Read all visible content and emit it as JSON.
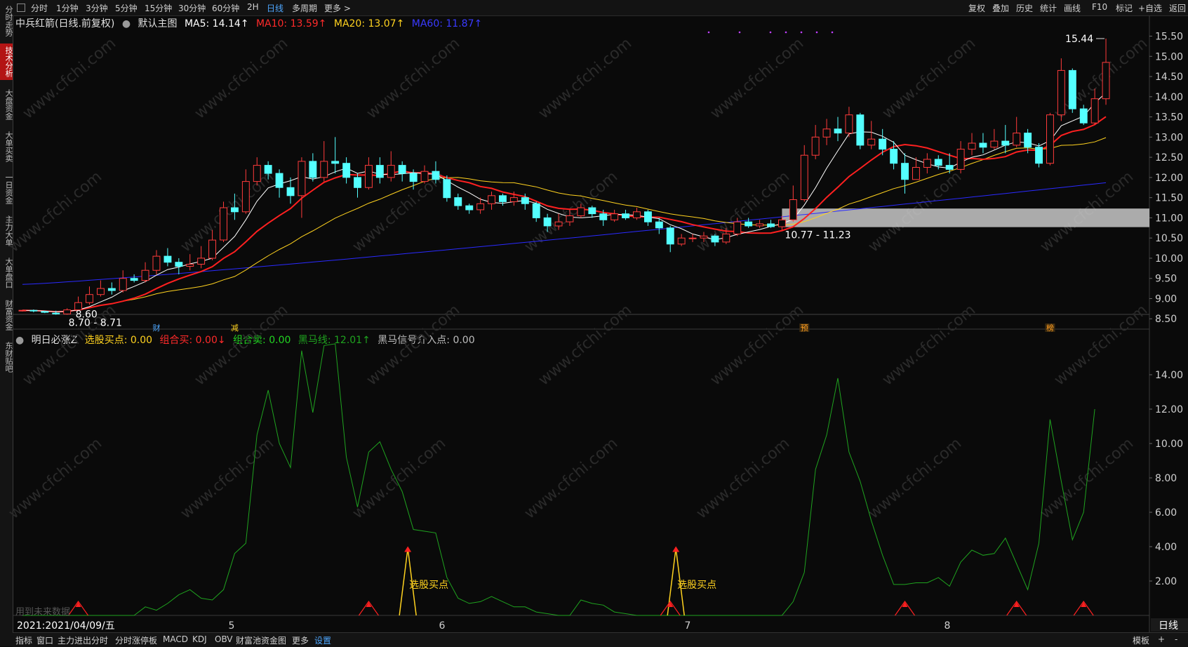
{
  "sidebar": {
    "items": [
      {
        "label": "分时走势",
        "active": false
      },
      {
        "label": "技术分析",
        "active": true
      },
      {
        "label": "大盘资金",
        "active": false
      },
      {
        "label": "大单买卖",
        "active": false
      },
      {
        "label": "一日资金",
        "active": false
      },
      {
        "label": "主力大单",
        "active": false
      },
      {
        "label": "大单盘口",
        "active": false
      },
      {
        "label": "财富资金",
        "active": false
      },
      {
        "label": "东财贴吧",
        "active": false
      }
    ]
  },
  "toolbar": {
    "periods": [
      "分时",
      "1分钟",
      "3分钟",
      "5分钟",
      "15分钟",
      "30分钟",
      "60分钟",
      "2H",
      "日线",
      "多周期",
      "更多 >"
    ],
    "active_period": "日线",
    "right_items": [
      "复权",
      "叠加",
      "历史",
      "统计",
      "画线",
      "F10",
      "标记",
      "+自选",
      "返回"
    ]
  },
  "main_title": {
    "stock": "中兵红箭(日线.前复权)",
    "template": "默认主图",
    "ma5": "MA5: 14.14↑",
    "ma10": "MA10: 13.59↑",
    "ma20": "MA20: 13.07↑",
    "ma60": "MA60: 11.87↑"
  },
  "sub_title": {
    "name": "明日必涨Z",
    "buy_point": "选股买点: 0.00",
    "combo_buy": "组合买: 0.00↓",
    "combo_sell": "组合卖: 0.00",
    "dark_horse": "黑马线: 12.01↑",
    "dark_horse_signal": "黑马信号介入点: 0.00"
  },
  "annotations": {
    "high_label": "15.44",
    "low_label": "8.60",
    "low_range": "8.70 - 8.71",
    "gap_range": "10.77 - 11.23",
    "buy_point_label": "选股买点",
    "future_data": "用到未来数据",
    "markers": [
      "财",
      "减",
      "预",
      "榜"
    ]
  },
  "colors": {
    "ma5": "#ffffff",
    "ma10": "#ff2020",
    "ma20": "#ffd21f",
    "ma60": "#2a2aff",
    "up": "#ff3b3b",
    "down": "#54ffff",
    "indicator": "#1fa31f",
    "accent": "#4ea7ff"
  },
  "price_axis": [
    "15.50",
    "15.00",
    "14.50",
    "14.00",
    "13.50",
    "13.00",
    "12.50",
    "12.00",
    "11.50",
    "11.00",
    "10.50",
    "10.00",
    "9.50",
    "9.00",
    "8.50"
  ],
  "indicator_axis": [
    "14.00",
    "12.00",
    "10.00",
    "8.00",
    "6.00",
    "4.00",
    "2.00"
  ],
  "time_axis": {
    "start_label": "2021:2021/04/09/五",
    "months": [
      "5",
      "6",
      "7",
      "8"
    ],
    "period_label": "日线"
  },
  "bottom_tabs": [
    "指标",
    "窗口",
    "主力进出分时",
    "分时涨停板",
    "MACD",
    "KDJ",
    "OBV",
    "财富池资金图",
    "更多",
    "设置"
  ],
  "bottom_right": [
    "模板",
    "+",
    "-"
  ],
  "watermark": "www.cfchi.com",
  "chart_data": {
    "type": "candlestick",
    "price_ylim": [
      8.4,
      15.7
    ],
    "candles": [
      [
        8.7,
        8.71,
        8.68,
        8.72
      ],
      [
        8.71,
        8.7,
        8.66,
        8.73
      ],
      [
        8.68,
        8.66,
        8.64,
        8.7
      ],
      [
        8.64,
        8.62,
        8.6,
        8.7
      ],
      [
        8.62,
        8.72,
        8.6,
        8.76
      ],
      [
        8.72,
        8.9,
        8.7,
        9.05
      ],
      [
        8.9,
        9.1,
        8.85,
        9.3
      ],
      [
        9.1,
        9.25,
        9.05,
        9.45
      ],
      [
        9.25,
        9.2,
        9.1,
        9.4
      ],
      [
        9.2,
        9.5,
        9.15,
        9.7
      ],
      [
        9.5,
        9.45,
        9.4,
        9.6
      ],
      [
        9.45,
        9.7,
        9.4,
        9.9
      ],
      [
        9.7,
        10.05,
        9.6,
        10.2
      ],
      [
        10.05,
        9.9,
        9.8,
        10.25
      ],
      [
        9.9,
        9.8,
        9.6,
        10.0
      ],
      [
        9.8,
        9.85,
        9.7,
        10.1
      ],
      [
        9.85,
        10.0,
        9.75,
        10.3
      ],
      [
        10.0,
        10.45,
        9.95,
        10.7
      ],
      [
        10.45,
        11.25,
        10.4,
        11.4
      ],
      [
        11.25,
        11.15,
        10.95,
        11.6
      ],
      [
        11.15,
        11.9,
        11.1,
        12.2
      ],
      [
        11.9,
        12.3,
        11.8,
        12.5
      ],
      [
        12.3,
        12.1,
        11.95,
        12.4
      ],
      [
        12.1,
        11.75,
        11.5,
        12.2
      ],
      [
        11.75,
        11.55,
        11.35,
        12.0
      ],
      [
        11.55,
        12.4,
        11.0,
        12.5
      ],
      [
        12.4,
        12.0,
        11.9,
        12.6
      ],
      [
        12.0,
        12.4,
        11.9,
        12.9
      ],
      [
        12.4,
        12.35,
        12.1,
        13.0
      ],
      [
        12.35,
        12.0,
        11.85,
        12.5
      ],
      [
        12.0,
        11.75,
        11.5,
        12.1
      ],
      [
        11.75,
        12.3,
        11.7,
        12.5
      ],
      [
        12.3,
        12.0,
        11.85,
        12.5
      ],
      [
        12.0,
        12.3,
        11.9,
        12.65
      ],
      [
        12.3,
        12.1,
        11.9,
        12.4
      ],
      [
        12.1,
        11.9,
        11.7,
        12.2
      ],
      [
        11.9,
        12.15,
        11.85,
        12.3
      ],
      [
        12.15,
        11.95,
        11.85,
        12.4
      ],
      [
        11.95,
        11.5,
        11.4,
        12.05
      ],
      [
        11.5,
        11.3,
        11.2,
        11.6
      ],
      [
        11.3,
        11.2,
        11.1,
        11.35
      ],
      [
        11.2,
        11.35,
        11.1,
        11.5
      ],
      [
        11.35,
        11.55,
        11.2,
        11.65
      ],
      [
        11.55,
        11.4,
        11.3,
        11.6
      ],
      [
        11.4,
        11.5,
        11.3,
        11.65
      ],
      [
        11.5,
        11.35,
        11.2,
        11.6
      ],
      [
        11.35,
        11.0,
        10.9,
        11.4
      ],
      [
        11.0,
        10.8,
        10.65,
        11.1
      ],
      [
        10.8,
        10.9,
        10.7,
        11.1
      ],
      [
        10.9,
        11.05,
        10.8,
        11.2
      ],
      [
        11.05,
        11.25,
        11.0,
        11.35
      ],
      [
        11.25,
        11.1,
        11.0,
        11.3
      ],
      [
        11.1,
        10.95,
        10.8,
        11.2
      ],
      [
        10.95,
        11.1,
        10.9,
        11.2
      ],
      [
        11.1,
        11.0,
        10.95,
        11.2
      ],
      [
        11.0,
        11.15,
        10.95,
        11.25
      ],
      [
        11.15,
        10.9,
        10.8,
        11.2
      ],
      [
        10.9,
        10.75,
        10.6,
        11.0
      ],
      [
        10.75,
        10.35,
        10.15,
        10.8
      ],
      [
        10.35,
        10.5,
        10.3,
        10.6
      ],
      [
        10.5,
        10.5,
        10.4,
        10.6
      ],
      [
        10.5,
        10.55,
        10.4,
        10.65
      ],
      [
        10.55,
        10.4,
        10.3,
        10.6
      ],
      [
        10.4,
        10.6,
        10.35,
        10.75
      ],
      [
        10.6,
        10.9,
        10.55,
        11.0
      ],
      [
        10.9,
        10.8,
        10.75,
        11.0
      ],
      [
        10.8,
        10.85,
        10.75,
        10.95
      ],
      [
        10.85,
        10.78,
        10.75,
        10.95
      ],
      [
        10.78,
        10.95,
        10.7,
        11.05
      ],
      [
        10.95,
        11.45,
        10.9,
        11.8
      ],
      [
        11.45,
        12.55,
        11.4,
        12.8
      ],
      [
        12.55,
        13.0,
        12.45,
        13.3
      ],
      [
        13.0,
        13.2,
        12.8,
        13.45
      ],
      [
        13.2,
        13.1,
        12.9,
        13.5
      ],
      [
        13.1,
        13.55,
        13.0,
        13.75
      ],
      [
        13.55,
        12.8,
        12.7,
        13.6
      ],
      [
        12.8,
        12.95,
        12.7,
        13.4
      ],
      [
        12.95,
        12.7,
        12.55,
        13.2
      ],
      [
        12.7,
        12.35,
        12.2,
        12.9
      ],
      [
        12.35,
        11.95,
        11.6,
        12.6
      ],
      [
        11.95,
        12.25,
        12.0,
        12.5
      ],
      [
        12.25,
        12.45,
        12.1,
        12.6
      ],
      [
        12.45,
        12.3,
        12.2,
        12.55
      ],
      [
        12.3,
        12.2,
        12.1,
        12.6
      ],
      [
        12.2,
        12.7,
        12.1,
        12.9
      ],
      [
        12.7,
        12.85,
        12.55,
        13.1
      ],
      [
        12.85,
        12.75,
        12.6,
        13.1
      ],
      [
        12.75,
        12.9,
        12.7,
        13.2
      ],
      [
        12.9,
        12.8,
        12.6,
        13.3
      ],
      [
        12.8,
        13.1,
        12.75,
        13.5
      ],
      [
        13.1,
        12.75,
        12.6,
        13.2
      ],
      [
        12.75,
        12.35,
        12.25,
        12.85
      ],
      [
        12.35,
        13.55,
        12.3,
        13.6
      ],
      [
        13.55,
        14.65,
        13.4,
        14.95
      ],
      [
        14.65,
        13.7,
        13.6,
        14.7
      ],
      [
        13.7,
        13.35,
        13.3,
        13.8
      ],
      [
        13.35,
        13.95,
        13.3,
        14.2
      ],
      [
        13.95,
        14.85,
        13.8,
        15.44
      ]
    ],
    "indicator_ylim": [
      0,
      16
    ],
    "indicator_series": [
      0,
      0,
      0,
      0,
      0,
      0,
      0,
      0,
      0,
      0,
      0,
      0.5,
      0.3,
      0.7,
      1.2,
      1.5,
      1.0,
      0.9,
      1.5,
      3.6,
      4.2,
      10.5,
      13.1,
      10.0,
      8.6,
      15.4,
      11.8,
      15.7,
      15.8,
      9.2,
      6.3,
      9.5,
      10.1,
      8.5,
      7.2,
      5.0,
      4.9,
      4.8,
      2.2,
      1.0,
      0.7,
      0.8,
      1.1,
      0.8,
      0.5,
      0.5,
      0.2,
      0.1,
      0,
      0,
      0.9,
      0.7,
      0.6,
      0.2,
      0.1,
      0,
      0,
      0,
      0,
      0,
      0,
      0,
      0,
      0,
      0,
      0,
      0,
      0,
      0,
      0.8,
      2.5,
      8.5,
      10.5,
      13.8,
      9.5,
      7.8,
      5.5,
      3.5,
      1.8,
      1.8,
      1.9,
      1.9,
      2.2,
      1.7,
      3.1,
      3.8,
      3.5,
      3.6,
      4.5,
      3.0,
      1.5,
      4.2,
      11.4,
      7.8,
      4.4,
      6.0,
      12.0
    ],
    "buy_points": [
      34,
      58
    ],
    "red_arrows": [
      5,
      31,
      58,
      79,
      89,
      95
    ]
  }
}
